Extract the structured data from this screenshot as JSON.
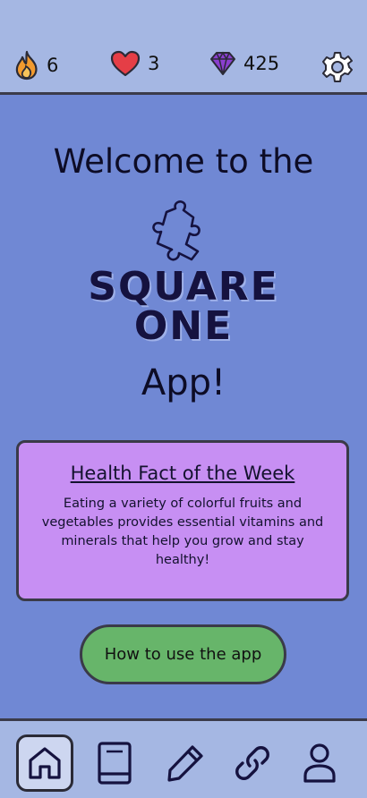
{
  "stats": {
    "streak": "6",
    "hearts": "3",
    "gems": "425"
  },
  "icons": {
    "streak": "flame-icon",
    "hearts": "heart-icon",
    "gems": "gem-icon",
    "settings": "gear-icon"
  },
  "main": {
    "welcome": "Welcome to the",
    "logo_line1": "SQUARE",
    "logo_line2": "ONE",
    "app_word": "App!",
    "fact_title": "Health Fact of the Week",
    "fact_body": "Eating a variety of colorful fruits and vegetables provides essential vitamins and minerals that help you grow and stay healthy!",
    "help_button": "How to use the app"
  },
  "nav": [
    "home-icon",
    "book-icon",
    "pencil-icon",
    "link-icon",
    "profile-icon"
  ],
  "colors": {
    "background": "#7088d4",
    "bar": "#a5b7e3",
    "fact_card": "#c78ff3",
    "help_button": "#67b56a",
    "heart": "#e53e46",
    "gem": "#8a3fcf",
    "flame": "#f29a2e"
  }
}
